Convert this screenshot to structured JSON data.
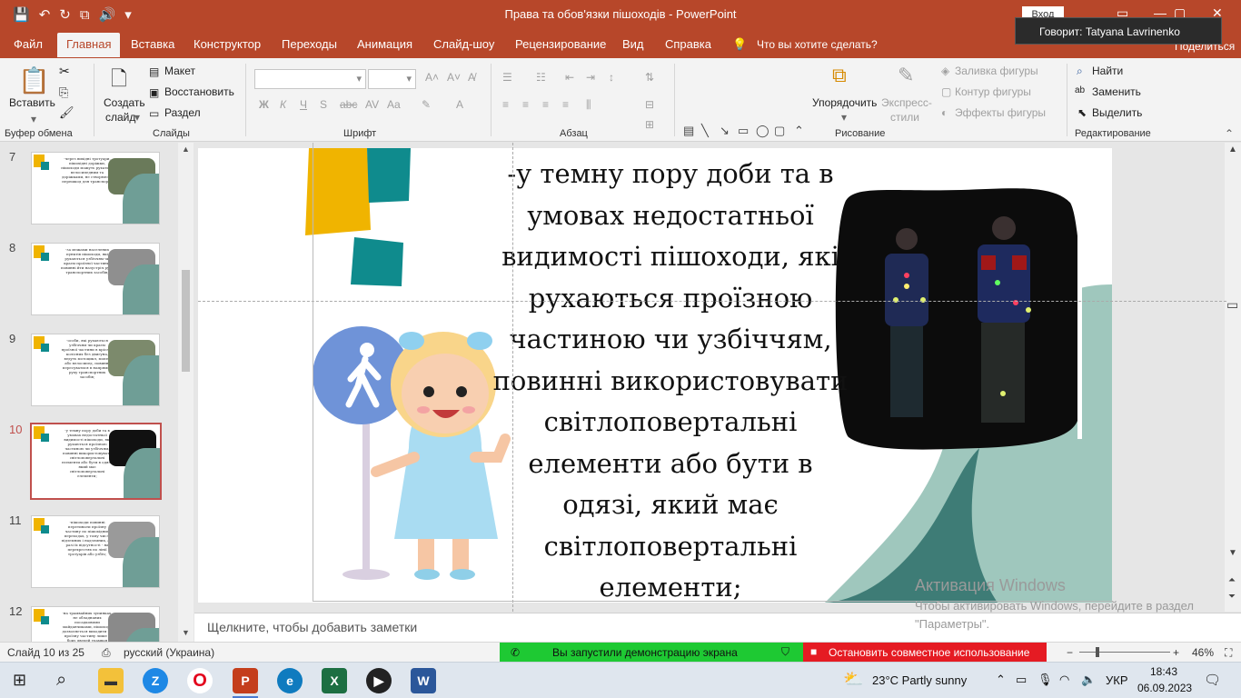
{
  "titlebar": {
    "document_title": "Права та обов'язки пішоходів  -  PowerPoint",
    "signin_label": "Вход",
    "speaker_tooltip": "Говорит: Tatyana Lavrinenko",
    "share_label": "Поделиться"
  },
  "tabs": [
    "Файл",
    "Главная",
    "Вставка",
    "Конструктор",
    "Переходы",
    "Анимация",
    "Слайд-шоу",
    "Рецензирование",
    "Вид",
    "Справка"
  ],
  "tell_me": "Что вы хотите сделать?",
  "ribbon": {
    "clipboard": {
      "label": "Буфер обмена",
      "paste": "Вставить"
    },
    "slides": {
      "label": "Слайды",
      "new_slide_1": "Создать",
      "new_slide_2": "слайд",
      "layout": "Макет",
      "reset": "Восстановить",
      "section": "Раздел"
    },
    "font": {
      "label": "Шрифт"
    },
    "paragraph": {
      "label": "Абзац"
    },
    "drawing": {
      "label": "Рисование",
      "arrange": "Упорядочить",
      "quick_styles_1": "Экспресс-",
      "quick_styles_2": "стили",
      "fill": "Заливка фигуры",
      "outline": "Контур фигуры",
      "effects": "Эффекты фигуры"
    },
    "editing": {
      "label": "Редактирование",
      "find": "Найти",
      "replace": "Заменить",
      "select": "Выделить"
    }
  },
  "thumbnails": [
    {
      "num": "7",
      "text": "-через вихідні тротуари, пішохідні доріжки, пішоходи можуть рухатися велосипедним та доріжками, не створюючи перешкод для транспорту"
    },
    {
      "num": "8",
      "text": "-за межами населених пунктів пішоходи, які рухаються узбіччям чи краєм проїзної частини, повинні йти назустріч руху транспортних засобів;"
    },
    {
      "num": "9",
      "text": "-особи, які рухаються узбіччям чи краєм проїзної частини в кріслах колісних без двигуна, ведуть мотоцикл, мопед або велосипед, повинні пересуватися в напрямку руху транспортних засобів;"
    },
    {
      "num": "10",
      "text": "-у темну пору доби та в умовах недостатньої видимості пішоходи, які рухаються проїзною частиною чи узбіччям, повинні використовувати світлоповертальні елементи або бути в одязі, який має світлоповертальні елементи;"
    },
    {
      "num": "11",
      "text": "-пішоходи повинні перетинати проїзну частину по пішохідних переходах, у тому числі підземних і надземних, а у разі їх відсутності - на перехрестях по лінії тротуарів або узбіч;"
    },
    {
      "num": "12",
      "text": "-на трамвайних зупинках, не обладнаних посадковими майданчиками, пішоходи дозволяється виходити на проїзну частину лише з боку дверей трамвая"
    }
  ],
  "slide": {
    "text_lines": [
      "-у темну пору доби та в",
      "умовах недостатньої",
      "видимості пішоходи, які",
      "рухаються проїзною",
      "частиною чи узбіччям,",
      "повинні використовувати",
      "світлоповертальні",
      "елементи або бути в",
      "одязі, який має",
      "світлоповертальні",
      "елементи;"
    ]
  },
  "notes_placeholder": "Щелкните, чтобы добавить заметки",
  "watermark": {
    "title": "Активация Windows",
    "subtitle": "Чтобы активировать Windows, перейдите в раздел \"Параметры\"."
  },
  "statusbar": {
    "slide_info": "Слайд 10 из 25",
    "language": "русский (Украина)",
    "share_banner": "Вы запустили демонстрацию экрана",
    "stop_banner": "Остановить совместное использование",
    "zoom": "46%"
  },
  "taskbar": {
    "weather": "23°C  Partly sunny",
    "lang": "УКР",
    "time": "18:43",
    "date": "06.09.2023"
  },
  "colors": {
    "accent": "#b7472a",
    "teal": "#0f8b8d",
    "yellow": "#f0b400",
    "green_banner": "#1ec933",
    "red_banner": "#e51b23"
  }
}
